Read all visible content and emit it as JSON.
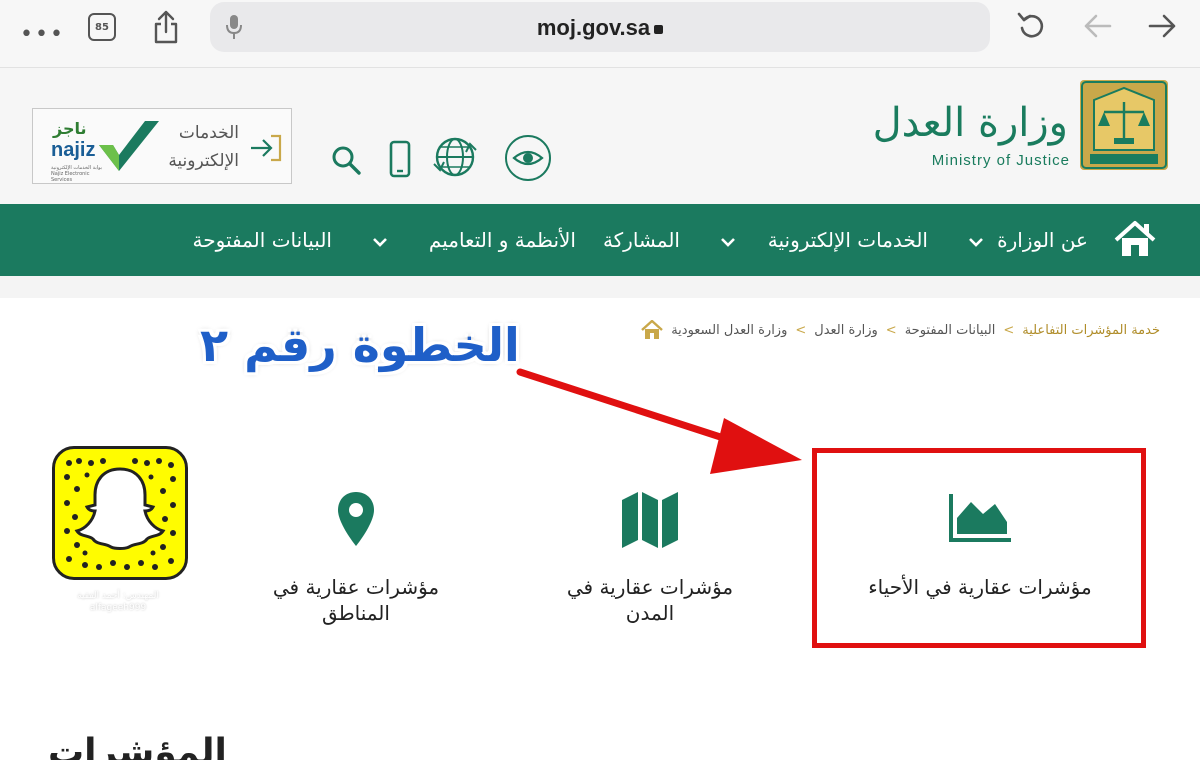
{
  "browser": {
    "url": "moj.gov.sa",
    "tabs_count": "85"
  },
  "header": {
    "logo_ar": "وزارة العدل",
    "logo_en": "Ministry of Justice",
    "najiz_ar": "ناجز",
    "najiz_en": "najiz",
    "najiz_tagline": "بوابة الخدمات الإلكترونية Najiz Electronic Services",
    "eservices_line1": "الخدمات",
    "eservices_line2": "الإلكترونية"
  },
  "nav": {
    "items": [
      {
        "label": "عن الوزارة"
      },
      {
        "label": "الخدمات الإلكترونية"
      },
      {
        "label": "المشاركة"
      },
      {
        "label": "الأنظمة و التعاميم"
      },
      {
        "label": "البيانات المفتوحة"
      }
    ]
  },
  "breadcrumb": {
    "items": [
      "وزارة العدل السعودية",
      "وزارة العدل",
      "البيانات المفتوحة"
    ],
    "current": "خدمة المؤشرات التفاعلية",
    "separator": ">"
  },
  "annotation": {
    "step_label": "الخطوة رقم ٢",
    "highlight_color": "#e01010"
  },
  "cards": [
    {
      "title": "مؤشرات عقارية في الأحياء",
      "icon": "area-chart-icon"
    },
    {
      "title_line1": "مؤشرات عقارية في",
      "title_line2": "المدن",
      "icon": "map-icon"
    },
    {
      "title_line1": "مؤشرات عقارية في",
      "title_line2": "المناطق",
      "icon": "location-pin-icon"
    }
  ],
  "snapcode": {
    "caption_line1": "المهندس: أحمد الفقية",
    "caption_line2": "alfageeh999"
  },
  "section": {
    "title": "المؤشرات"
  },
  "colors": {
    "brand_green": "#1b7a5f",
    "gold": "#c9a84a",
    "annotation_blue": "#1f5fc8",
    "annotation_red": "#e01010"
  }
}
